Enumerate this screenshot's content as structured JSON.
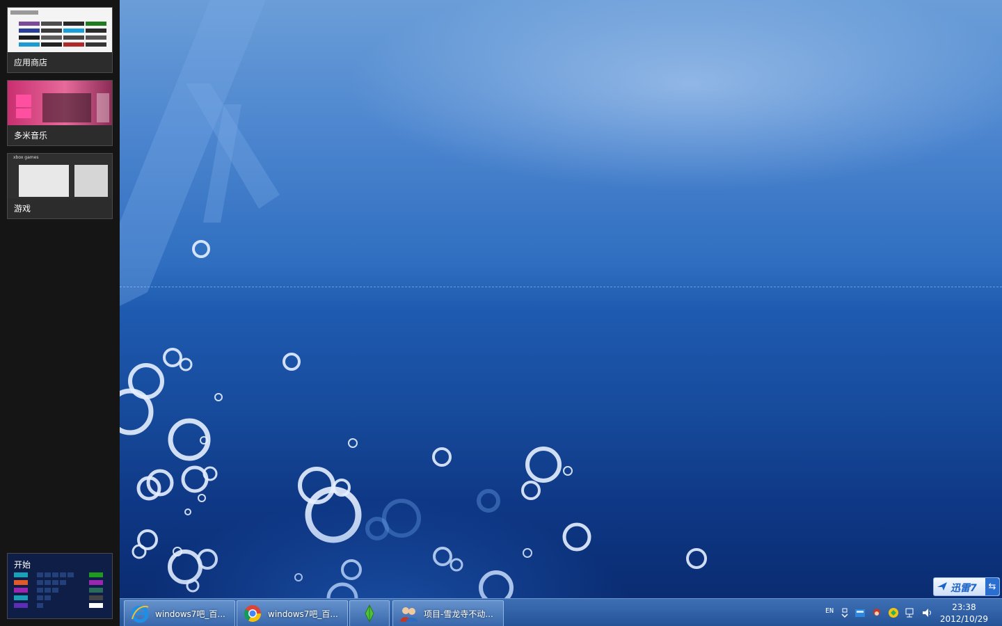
{
  "switcher": {
    "apps": [
      {
        "label": "应用商店"
      },
      {
        "label": "多米音乐"
      },
      {
        "label": "游戏",
        "preview_title": "xbox games"
      }
    ],
    "start": {
      "label": "开始"
    }
  },
  "taskbar": {
    "buttons": [
      {
        "label": "windows7吧_百...",
        "icon": "ie-icon"
      },
      {
        "label": "windows7吧_百...",
        "icon": "chrome-icon"
      },
      {
        "label": "",
        "icon": "sims-plumbob-icon"
      },
      {
        "label": "项目-雪龙寺不动...",
        "icon": "contacts-icon"
      }
    ],
    "tray": {
      "language": "EN",
      "clock_time": "23:38",
      "clock_date": "2012/10/29"
    }
  },
  "xunlei": {
    "label": "迅雷7",
    "switch_symbol": "⇆"
  },
  "colors": {
    "taskbar": "#3f6fb0",
    "switcher_bg": "#151515",
    "accent": "#1c64c8"
  }
}
